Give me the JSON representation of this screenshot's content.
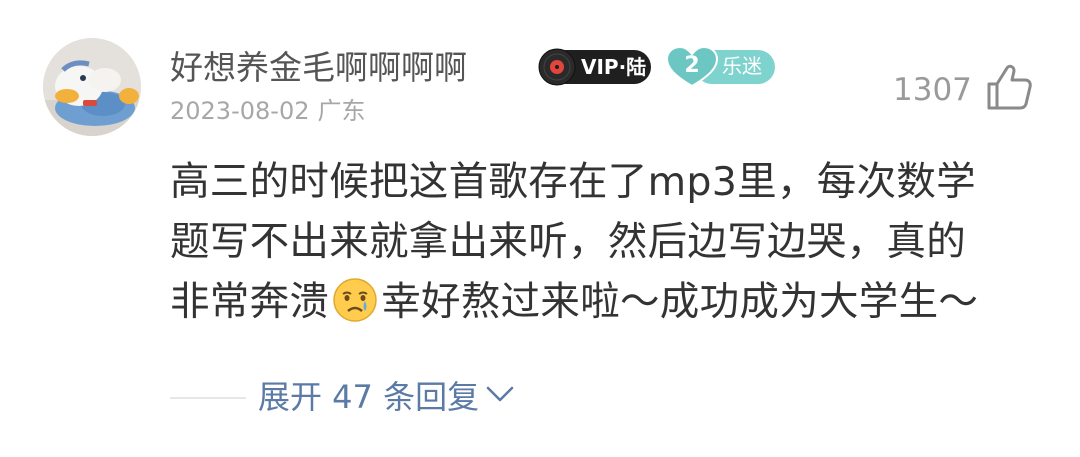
{
  "comment": {
    "username": "好想养金毛啊啊啊啊",
    "vip_badge_label": "VIP·陆",
    "level_badge": {
      "number": "2",
      "label": "乐迷"
    },
    "date": "2023-08-02",
    "location": "广东",
    "like_count": "1307",
    "body_lines": [
      "高三的时候把这首歌存在了mp3里，每次数学",
      "题写不出来就拿出来听，然后边写边哭，真的",
      "非常奔溃"
    ],
    "body_line3_after_emoji": "幸好熬过来啦～成功成为大学生～",
    "expand_replies": "展开 47 条回复"
  },
  "icons": {
    "avatar": "plush-toy-avatar",
    "vip": "vinyl-record-icon",
    "level": "heart-level-icon",
    "like": "thumbs-up-icon",
    "emoji": "crying-face-emoji",
    "expand": "chevron-down-icon"
  },
  "colors": {
    "username": "#555555",
    "meta": "#a7a7a7",
    "body": "#333333",
    "link": "#5b7aa5",
    "vip_badge": "#1f1f1f",
    "level_badge": "#7fd3cf"
  }
}
